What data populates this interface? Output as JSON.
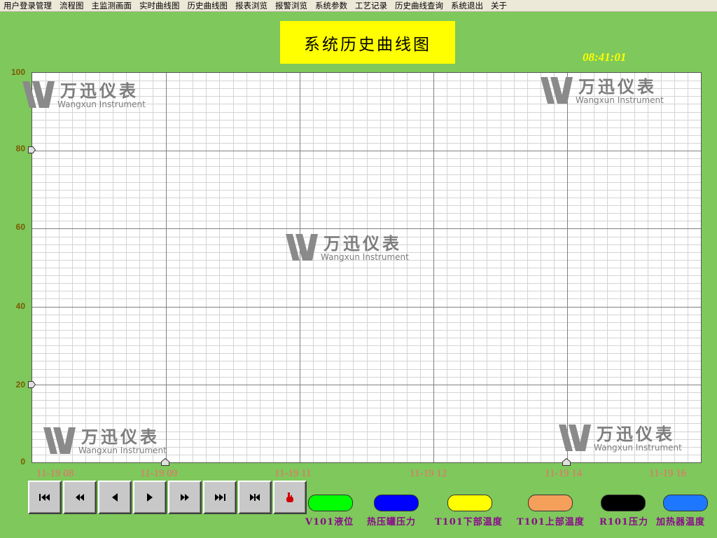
{
  "menu": [
    "用户登录管理",
    "流程图",
    "主监测画面",
    "实时曲线图",
    "历史曲线图",
    "报表浏览",
    "报警浏览",
    "系统参数",
    "工艺记录",
    "历史曲线查询",
    "系统退出",
    "关于"
  ],
  "title": "系统历史曲线图",
  "clock": "08:41:01",
  "watermark": {
    "cn": "万迅仪表",
    "en": "Wangxun Instrument"
  },
  "chart_data": {
    "type": "line",
    "ylim": [
      0,
      100
    ],
    "yticks": [
      "100",
      "80",
      "60",
      "40",
      "20",
      "0"
    ],
    "xticks": [
      "11-19 08",
      "11-19 09",
      "11-19 11",
      "11-19 12",
      "11-19 14",
      "11-19 16"
    ],
    "grid": true,
    "series": [
      {
        "name": "V101液位",
        "color": "#00ff00",
        "values": []
      },
      {
        "name": "热压罐压力",
        "color": "#0000ff",
        "values": []
      },
      {
        "name": "T101下部温度",
        "color": "#ffff00",
        "values": []
      },
      {
        "name": "T101上部温度",
        "color": "#f5a05a",
        "values": []
      },
      {
        "name": "R101压力",
        "color": "#000000",
        "values": []
      },
      {
        "name": "加热器温度",
        "color": "#1e78ff",
        "values": []
      }
    ]
  },
  "buttons": [
    {
      "name": "first-button",
      "icon": "skip-first-icon"
    },
    {
      "name": "fast-rewind-button",
      "icon": "fast-rewind-icon"
    },
    {
      "name": "step-back-button",
      "icon": "step-back-icon"
    },
    {
      "name": "play-button",
      "icon": "play-icon"
    },
    {
      "name": "fast-forward-button",
      "icon": "fast-forward-icon"
    },
    {
      "name": "last-button",
      "icon": "skip-last-icon"
    },
    {
      "name": "jump-button",
      "icon": "jump-icon"
    },
    {
      "name": "pointer-button",
      "icon": "hand-pointer-icon"
    }
  ]
}
